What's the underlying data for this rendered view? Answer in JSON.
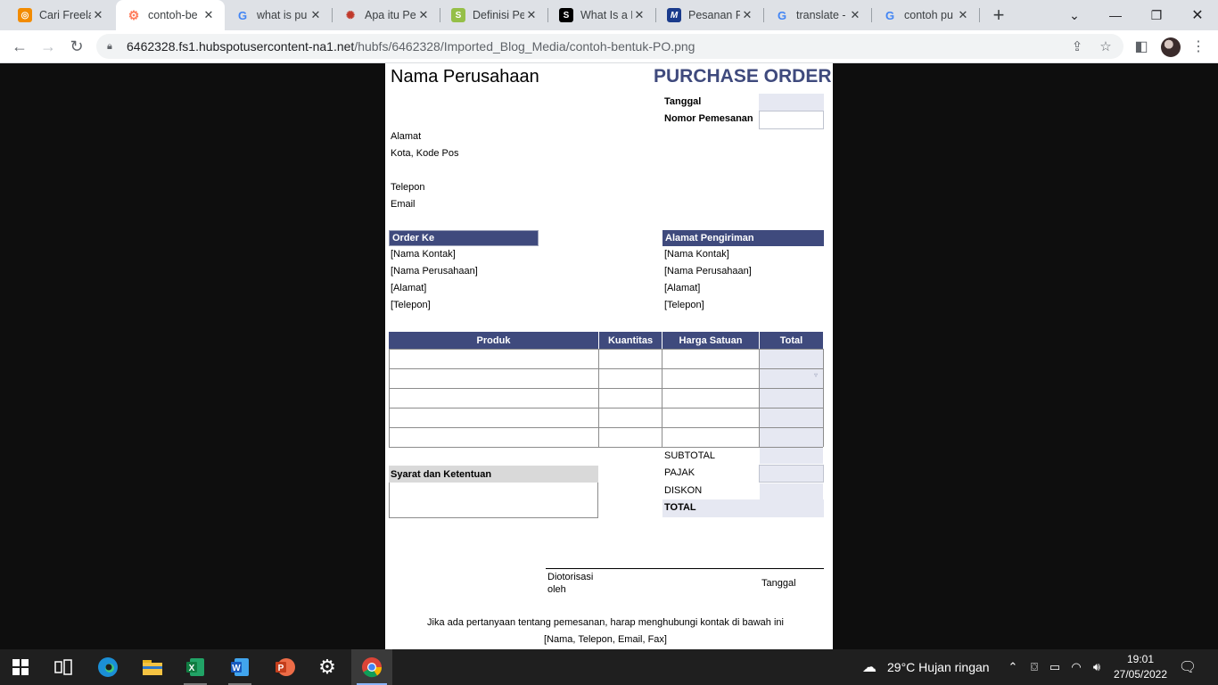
{
  "browser": {
    "tabs": [
      {
        "title": "Cari Freela",
        "favicon": "freelancer-favicon",
        "color": "#f28b00"
      },
      {
        "title": "contoh-be",
        "favicon": "hubspot-favicon",
        "color": "#ff7a59",
        "active": true
      },
      {
        "title": "what is pu",
        "favicon": "google-favicon",
        "color": "#4285f4"
      },
      {
        "title": "Apa itu Pe",
        "favicon": "ant-favicon",
        "color": "#c0392b"
      },
      {
        "title": "Definisi Pe",
        "favicon": "shopify-favicon",
        "color": "#95bf47"
      },
      {
        "title": "What Is a P",
        "favicon": "squarespace-favicon",
        "color": "#000000"
      },
      {
        "title": "Pesanan Pe",
        "favicon": "m-favicon",
        "color": "#1a3b8c"
      },
      {
        "title": "translate -",
        "favicon": "google-favicon",
        "color": "#4285f4"
      },
      {
        "title": "contoh pu",
        "favicon": "google-favicon",
        "color": "#4285f4"
      }
    ],
    "url_host": "6462328.fs1.hubspotusercontent-na1.net",
    "url_path": "/hubfs/6462328/Imported_Blog_Media/contoh-bentuk-PO.png"
  },
  "po": {
    "company_name": "Nama Perusahaan",
    "title": "PURCHASE ORDER",
    "date_label": "Tanggal",
    "order_number_label": "Nomor Pemesanan",
    "address": "Alamat",
    "city_zip": "Kota, Kode Pos",
    "phone": "Telepon",
    "email": "Email",
    "order_to": {
      "header": "Order Ke",
      "lines": [
        "[Nama Kontak]",
        "[Nama Perusahaan]",
        "[Alamat]",
        "[Telepon]"
      ]
    },
    "ship_to": {
      "header": "Alamat Pengiriman",
      "lines": [
        "[Nama Kontak]",
        "[Nama Perusahaan]",
        "[Alamat]",
        "[Telepon]"
      ]
    },
    "table_headers": [
      "Produk",
      "Kuantitas",
      "Harga Satuan",
      "Total"
    ],
    "terms_header": "Syarat dan Ketentuan",
    "summary": [
      "SUBTOTAL",
      "PAJAK",
      "DISKON",
      "TOTAL"
    ],
    "authorized_by": "Diotorisasi oleh",
    "signature_date": "Tanggal",
    "footer_note": "Jika ada pertanyaan tentang pemesanan, harap menghubungi kontak di bawah ini",
    "footer_contact": "[Nama, Telepon, Email, Fax]"
  },
  "taskbar": {
    "weather": "29°C  Hujan ringan",
    "time": "19:01",
    "date": "27/05/2022"
  },
  "colors": {
    "po_navy": "#3f4a7d",
    "po_fill": "#e6e8f2"
  }
}
